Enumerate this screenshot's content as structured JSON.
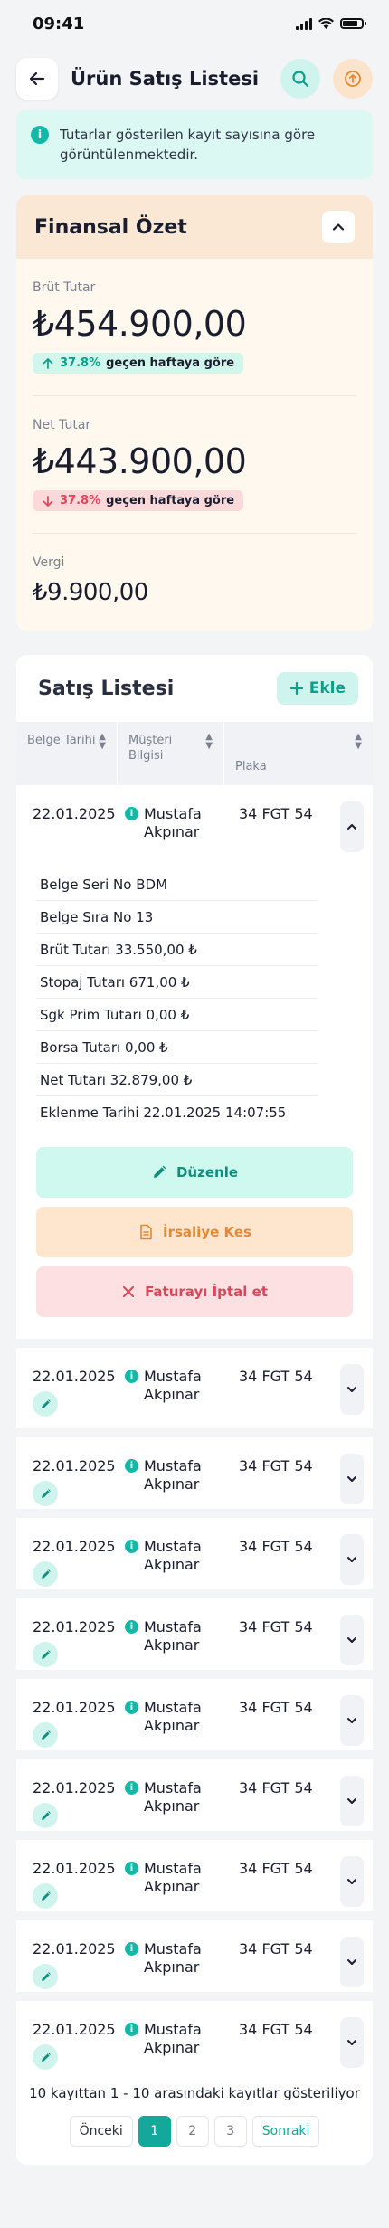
{
  "status_bar": {
    "time": "09:41"
  },
  "header": {
    "title": "Ürün Satış Listesi"
  },
  "info_banner": {
    "text": "Tutarlar gösterilen kayıt sayısına göre görüntülenmektedir."
  },
  "financial_summary": {
    "title": "Finansal Özet",
    "gross": {
      "label": "Brüt Tutar",
      "value": "₺454.900,00",
      "trend_pct": "37.8%",
      "trend_text": "geçen haftaya göre",
      "trend_direction": "up"
    },
    "net": {
      "label": "Net Tutar",
      "value": "₺443.900,00",
      "trend_pct": "37.8%",
      "trend_text": "geçen haftaya göre",
      "trend_direction": "down"
    },
    "tax": {
      "label": "Vergi",
      "value": "₺9.900,00"
    }
  },
  "sales": {
    "title": "Satış Listesi",
    "add_label": "Ekle",
    "columns": [
      "Belge Tarihi",
      "Müşteri Bilgisi",
      "Plaka"
    ],
    "expanded_row": {
      "date": "22.01.2025",
      "customer": "Mustafa Akpınar",
      "plate": "34 FGT 54",
      "details": [
        "Belge Seri No BDM",
        "Belge Sıra No 13",
        "Brüt Tutarı 33.550,00 ₺",
        "Stopaj Tutarı 671,00 ₺",
        "Sgk Prim Tutarı 0,00 ₺",
        "Borsa Tutarı 0,00 ₺",
        "Net Tutarı 32.879,00 ₺",
        "Eklenme Tarihi 22.01.2025 14:07:55"
      ],
      "actions": {
        "edit": "Düzenle",
        "waybill": "İrsaliye Kes",
        "cancel": "Faturayı İptal et"
      }
    },
    "rows": [
      {
        "date": "22.01.2025",
        "customer": "Mustafa Akpınar",
        "plate": "34 FGT 54"
      },
      {
        "date": "22.01.2025",
        "customer": "Mustafa Akpınar",
        "plate": "34 FGT 54"
      },
      {
        "date": "22.01.2025",
        "customer": "Mustafa Akpınar",
        "plate": "34 FGT 54"
      },
      {
        "date": "22.01.2025",
        "customer": "Mustafa Akpınar",
        "plate": "34 FGT 54"
      },
      {
        "date": "22.01.2025",
        "customer": "Mustafa Akpınar",
        "plate": "34 FGT 54"
      },
      {
        "date": "22.01.2025",
        "customer": "Mustafa Akpınar",
        "plate": "34 FGT 54"
      },
      {
        "date": "22.01.2025",
        "customer": "Mustafa Akpınar",
        "plate": "34 FGT 54"
      },
      {
        "date": "22.01.2025",
        "customer": "Mustafa Akpınar",
        "plate": "34 FGT 54"
      },
      {
        "date": "22.01.2025",
        "customer": "Mustafa Akpınar",
        "plate": "34 FGT 54"
      }
    ],
    "footer_text": "10 kayıttan 1 - 10 arasındaki kayıtlar gösteriliyor",
    "pagination": {
      "prev": "Önceki",
      "pages": [
        "1",
        "2",
        "3"
      ],
      "active_page": "1",
      "next": "Sonraki"
    }
  },
  "colors": {
    "accent": "#14B8A6",
    "positive": "#0E9F8A",
    "negative": "#E0485A",
    "warning": "#E08A36"
  }
}
